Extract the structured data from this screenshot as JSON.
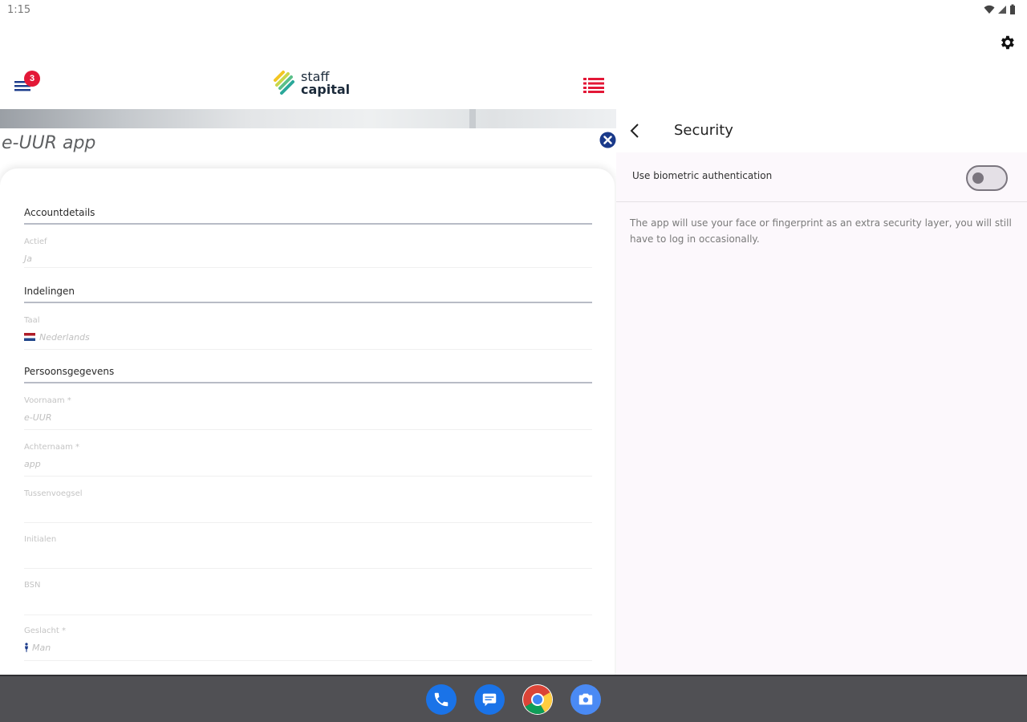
{
  "status_bar": {
    "time": "1:15"
  },
  "header": {
    "logo_top": "staff",
    "logo_bottom": "capital",
    "notification_count": "3"
  },
  "app": {
    "title": "e-UUR app"
  },
  "form": {
    "sections": {
      "account": "Accountdetails",
      "settings": "Indelingen",
      "personal": "Persoonsgegevens"
    },
    "fields": {
      "active": {
        "label": "Actief",
        "value": "Ja"
      },
      "language": {
        "label": "Taal",
        "value": "Nederlands"
      },
      "first_name": {
        "label": "Voornaam *",
        "value": "e-UUR"
      },
      "last_name": {
        "label": "Achternaam *",
        "value": "app"
      },
      "prefix": {
        "label": "Tussenvoegsel",
        "value": ""
      },
      "initials": {
        "label": "Initialen",
        "value": ""
      },
      "bsn": {
        "label": "BSN",
        "value": ""
      },
      "gender": {
        "label": "Geslacht *",
        "value": "Man"
      }
    }
  },
  "security": {
    "title": "Security",
    "biometric_label": "Use biometric authentication",
    "biometric_enabled": false,
    "description": "The app will use your face or fingerprint as an extra security layer, you will still have to log in occasionally."
  },
  "dock": {
    "apps": [
      "phone-icon",
      "messages-icon",
      "chrome-icon",
      "camera-icon"
    ]
  },
  "colors": {
    "brand_red": "#e31837",
    "brand_navy": "#1a3a8a"
  }
}
